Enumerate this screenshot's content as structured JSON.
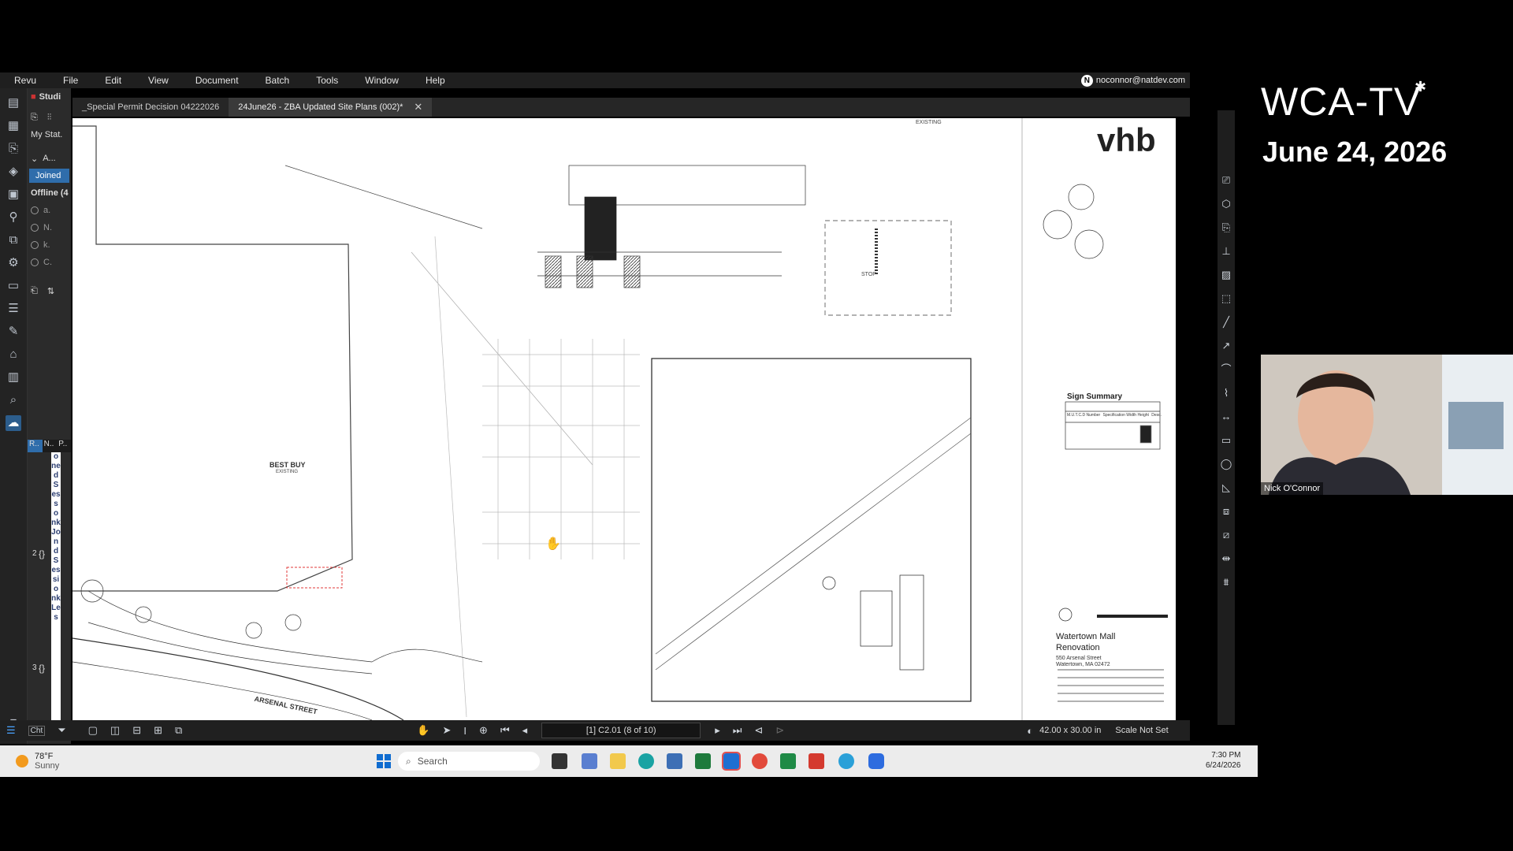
{
  "menu": [
    "Revu",
    "File",
    "Edit",
    "View",
    "Document",
    "Batch",
    "Tools",
    "Window",
    "Help"
  ],
  "user": {
    "email": "noconnor@natdev.com",
    "initial": "N"
  },
  "studio": {
    "title": "Studi",
    "session": "My Stat.",
    "section": "A...",
    "joined": "Joined",
    "offline": "Offline (4",
    "attendees": [
      "a.",
      "N.",
      "k.",
      "C."
    ],
    "columns": [
      "R..",
      "N..",
      "P.."
    ],
    "row_numbers": [
      "2",
      "3"
    ],
    "vertical_text": "onedSess onkJondSessionkLe s"
  },
  "tabs": [
    {
      "label": "_Special Permit Decision 04222026",
      "active": false
    },
    {
      "label": "24June26 - ZBA Updated Site Plans (002)*",
      "active": true
    }
  ],
  "drawing": {
    "logo": "vhb",
    "store_label": "BEST BUY",
    "store_sub": "EXISTING",
    "street": "ARSENAL STREET",
    "top_note": "EXISTING",
    "stop": "STOP",
    "sign_summary": "Sign Summary",
    "sign_cols": [
      "M.U.T.C.D Number",
      "Specification Width  Height",
      "Desc."
    ],
    "project_title_1": "Watertown Mall",
    "project_title_2": "Renovation",
    "address_1": "550 Arsenal Street",
    "address_2": "Watertown, MA 02472"
  },
  "status": {
    "page": "[1] C2.01 (8 of 10)",
    "size": "42.00 x 30.00 in",
    "scale": "Scale Not Set",
    "chat_label": "Cht"
  },
  "taskbar": {
    "temp": "78°F",
    "weather": "Sunny",
    "search_placeholder": "Search",
    "time": "7:30 PM",
    "date": "6/24/2026"
  },
  "broadcast": {
    "brand": "WCA-TV",
    "date": "June 24, 2026",
    "speaker": "Nick O'Connor"
  },
  "colors": {
    "accent": "#2f6dab",
    "panel": "#2b2b2b",
    "toolbar": "#232323"
  }
}
